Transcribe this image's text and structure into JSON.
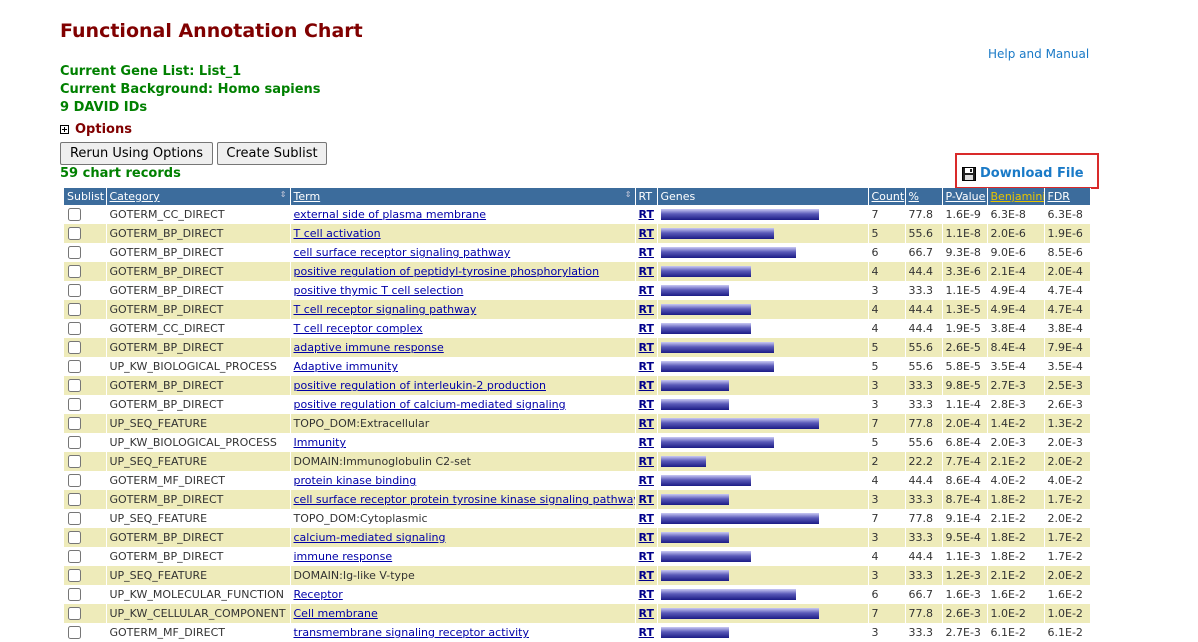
{
  "page": {
    "title": "Functional Annotation Chart",
    "help_link": "Help and Manual",
    "gene_list": "Current Gene List: List_1",
    "background": "Current Background: Homo sapiens",
    "ids": "9 DAVID IDs",
    "options": "Options",
    "rerun_button": "Rerun Using Options",
    "sublist_button": "Create Sublist",
    "records": "59 chart records",
    "download": "Download File"
  },
  "table": {
    "headers": {
      "sublist": "Sublist",
      "category": "Category",
      "term": "Term",
      "rt": "RT",
      "genes": "Genes",
      "count": "Count",
      "percent": "%",
      "pvalue": "P-Value",
      "benjamini": "Benjamini",
      "fdr": "FDR"
    },
    "rows": [
      {
        "category": "GOTERM_CC_DIRECT",
        "term": "external side of plasma membrane",
        "link": true,
        "rt": "RT",
        "count": "7",
        "percent": "77.8",
        "pvalue": "1.6E-9",
        "benjamini": "6.3E-8",
        "fdr": "6.3E-8"
      },
      {
        "category": "GOTERM_BP_DIRECT",
        "term": "T cell activation",
        "link": true,
        "rt": "RT",
        "count": "5",
        "percent": "55.6",
        "pvalue": "1.1E-8",
        "benjamini": "2.0E-6",
        "fdr": "1.9E-6"
      },
      {
        "category": "GOTERM_BP_DIRECT",
        "term": "cell surface receptor signaling pathway",
        "link": true,
        "rt": "RT",
        "count": "6",
        "percent": "66.7",
        "pvalue": "9.3E-8",
        "benjamini": "9.0E-6",
        "fdr": "8.5E-6"
      },
      {
        "category": "GOTERM_BP_DIRECT",
        "term": "positive regulation of peptidyl-tyrosine phosphorylation",
        "link": true,
        "rt": "RT",
        "count": "4",
        "percent": "44.4",
        "pvalue": "3.3E-6",
        "benjamini": "2.1E-4",
        "fdr": "2.0E-4"
      },
      {
        "category": "GOTERM_BP_DIRECT",
        "term": "positive thymic T cell selection",
        "link": true,
        "rt": "RT",
        "count": "3",
        "percent": "33.3",
        "pvalue": "1.1E-5",
        "benjamini": "4.9E-4",
        "fdr": "4.7E-4"
      },
      {
        "category": "GOTERM_BP_DIRECT",
        "term": "T cell receptor signaling pathway",
        "link": true,
        "rt": "RT",
        "count": "4",
        "percent": "44.4",
        "pvalue": "1.3E-5",
        "benjamini": "4.9E-4",
        "fdr": "4.7E-4"
      },
      {
        "category": "GOTERM_CC_DIRECT",
        "term": "T cell receptor complex",
        "link": true,
        "rt": "RT",
        "count": "4",
        "percent": "44.4",
        "pvalue": "1.9E-5",
        "benjamini": "3.8E-4",
        "fdr": "3.8E-4"
      },
      {
        "category": "GOTERM_BP_DIRECT",
        "term": "adaptive immune response",
        "link": true,
        "rt": "RT",
        "count": "5",
        "percent": "55.6",
        "pvalue": "2.6E-5",
        "benjamini": "8.4E-4",
        "fdr": "7.9E-4"
      },
      {
        "category": "UP_KW_BIOLOGICAL_PROCESS",
        "term": "Adaptive immunity",
        "link": true,
        "rt": "RT",
        "count": "5",
        "percent": "55.6",
        "pvalue": "5.8E-5",
        "benjamini": "3.5E-4",
        "fdr": "3.5E-4"
      },
      {
        "category": "GOTERM_BP_DIRECT",
        "term": "positive regulation of interleukin-2 production",
        "link": true,
        "rt": "RT",
        "count": "3",
        "percent": "33.3",
        "pvalue": "9.8E-5",
        "benjamini": "2.7E-3",
        "fdr": "2.5E-3"
      },
      {
        "category": "GOTERM_BP_DIRECT",
        "term": "positive regulation of calcium-mediated signaling",
        "link": true,
        "rt": "RT",
        "count": "3",
        "percent": "33.3",
        "pvalue": "1.1E-4",
        "benjamini": "2.8E-3",
        "fdr": "2.6E-3"
      },
      {
        "category": "UP_SEQ_FEATURE",
        "term": "TOPO_DOM:Extracellular",
        "link": false,
        "rt": "RT",
        "count": "7",
        "percent": "77.8",
        "pvalue": "2.0E-4",
        "benjamini": "1.4E-2",
        "fdr": "1.3E-2"
      },
      {
        "category": "UP_KW_BIOLOGICAL_PROCESS",
        "term": "Immunity",
        "link": true,
        "rt": "RT",
        "count": "5",
        "percent": "55.6",
        "pvalue": "6.8E-4",
        "benjamini": "2.0E-3",
        "fdr": "2.0E-3"
      },
      {
        "category": "UP_SEQ_FEATURE",
        "term": "DOMAIN:Immunoglobulin C2-set",
        "link": false,
        "rt": "RT",
        "count": "2",
        "percent": "22.2",
        "pvalue": "7.7E-4",
        "benjamini": "2.1E-2",
        "fdr": "2.0E-2"
      },
      {
        "category": "GOTERM_MF_DIRECT",
        "term": "protein kinase binding",
        "link": true,
        "rt": "RT",
        "count": "4",
        "percent": "44.4",
        "pvalue": "8.6E-4",
        "benjamini": "4.0E-2",
        "fdr": "4.0E-2"
      },
      {
        "category": "GOTERM_BP_DIRECT",
        "term": "cell surface receptor protein tyrosine kinase signaling pathway",
        "link": true,
        "rt": "RT",
        "count": "3",
        "percent": "33.3",
        "pvalue": "8.7E-4",
        "benjamini": "1.8E-2",
        "fdr": "1.7E-2"
      },
      {
        "category": "UP_SEQ_FEATURE",
        "term": "TOPO_DOM:Cytoplasmic",
        "link": false,
        "rt": "RT",
        "count": "7",
        "percent": "77.8",
        "pvalue": "9.1E-4",
        "benjamini": "2.1E-2",
        "fdr": "2.0E-2"
      },
      {
        "category": "GOTERM_BP_DIRECT",
        "term": "calcium-mediated signaling",
        "link": true,
        "rt": "RT",
        "count": "3",
        "percent": "33.3",
        "pvalue": "9.5E-4",
        "benjamini": "1.8E-2",
        "fdr": "1.7E-2"
      },
      {
        "category": "GOTERM_BP_DIRECT",
        "term": "immune response",
        "link": true,
        "rt": "RT",
        "count": "4",
        "percent": "44.4",
        "pvalue": "1.1E-3",
        "benjamini": "1.8E-2",
        "fdr": "1.7E-2"
      },
      {
        "category": "UP_SEQ_FEATURE",
        "term": "DOMAIN:Ig-like V-type",
        "link": false,
        "rt": "RT",
        "count": "3",
        "percent": "33.3",
        "pvalue": "1.2E-3",
        "benjamini": "2.1E-2",
        "fdr": "2.0E-2"
      },
      {
        "category": "UP_KW_MOLECULAR_FUNCTION",
        "term": "Receptor",
        "link": true,
        "rt": "RT",
        "count": "6",
        "percent": "66.7",
        "pvalue": "1.6E-3",
        "benjamini": "1.6E-2",
        "fdr": "1.6E-2"
      },
      {
        "category": "UP_KW_CELLULAR_COMPONENT",
        "term": "Cell membrane",
        "link": true,
        "rt": "RT",
        "count": "7",
        "percent": "77.8",
        "pvalue": "2.6E-3",
        "benjamini": "1.0E-2",
        "fdr": "1.0E-2"
      },
      {
        "category": "GOTERM_MF_DIRECT",
        "term": "transmembrane signaling receptor activity",
        "link": true,
        "rt": "RT",
        "count": "3",
        "percent": "33.3",
        "pvalue": "2.7E-3",
        "benjamini": "6.1E-2",
        "fdr": "6.1E-2"
      }
    ]
  }
}
